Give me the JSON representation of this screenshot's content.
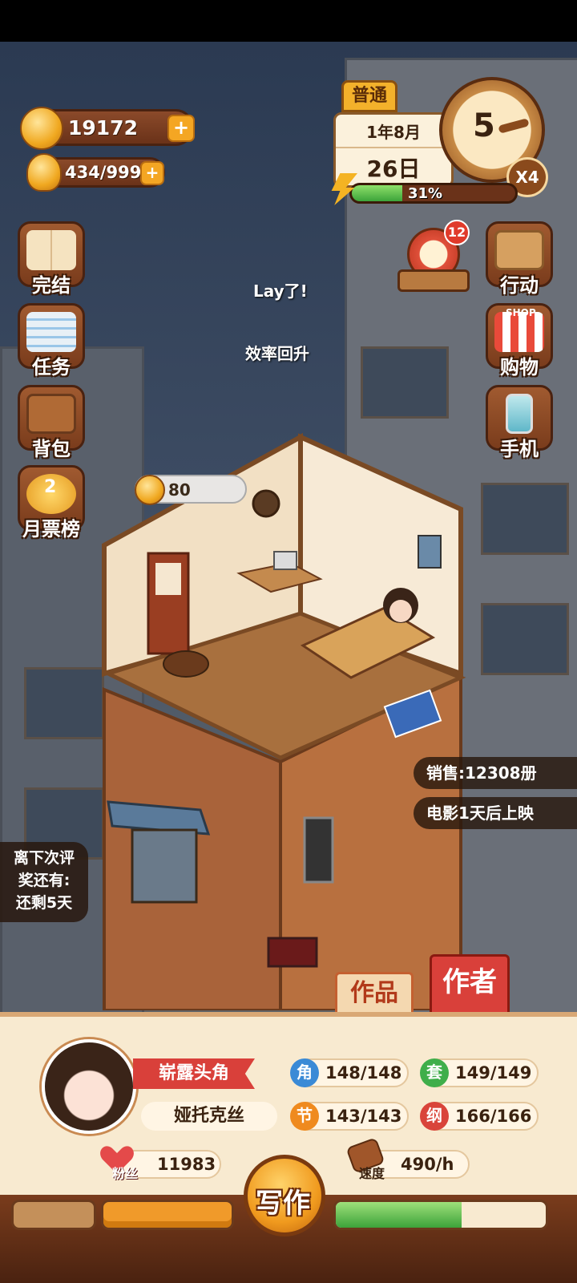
{
  "currency": {
    "coins": "19172",
    "inspiration": "434/999"
  },
  "date": {
    "mode": "普通",
    "month": "1年8月",
    "day": "26日",
    "clock_value": "5",
    "speed": "X4",
    "energy_percent": "31%",
    "energy_fraction": 0.31
  },
  "side_left": [
    {
      "label": "完结",
      "icon": "book-icon"
    },
    {
      "label": "任务",
      "icon": "checklist-icon"
    },
    {
      "label": "背包",
      "icon": "bag-icon"
    },
    {
      "label": "月票榜",
      "icon": "ticket-medal-icon",
      "badge": "2"
    }
  ],
  "side_right": [
    {
      "label": "行动",
      "icon": "door-icon"
    },
    {
      "label": "购物",
      "icon": "shop-icon",
      "sign": "SHOP"
    },
    {
      "label": "手机",
      "icon": "phone-icon"
    }
  ],
  "event_badge": "12",
  "float_texts": {
    "line1": "Lay了!",
    "line2": "效率回升"
  },
  "room_coin": "80",
  "info": {
    "sales": "销售:12308册",
    "movie": "电影1天后上映"
  },
  "award": {
    "line1": "离下次评",
    "line2": "奖还有:",
    "line3": "还剩5天"
  },
  "tabs": {
    "works": "作品",
    "author": "作者"
  },
  "profile": {
    "title": "崭露头角",
    "name": "娅托克丝",
    "stats": [
      {
        "icon": "角",
        "value": "148/148",
        "color": "#3a8ad6"
      },
      {
        "icon": "套",
        "value": "149/149",
        "color": "#3fae4a"
      },
      {
        "icon": "节",
        "value": "143/143",
        "color": "#ef8a1e"
      },
      {
        "icon": "纲",
        "value": "166/166",
        "color": "#d9443a"
      }
    ],
    "fans_label": "粉丝",
    "fans": "11983",
    "speed_label": "速度",
    "speed": "490/h"
  },
  "write_button": "写作",
  "progress": {
    "left": 0.0,
    "middle": 1.0,
    "right": 0.6
  }
}
